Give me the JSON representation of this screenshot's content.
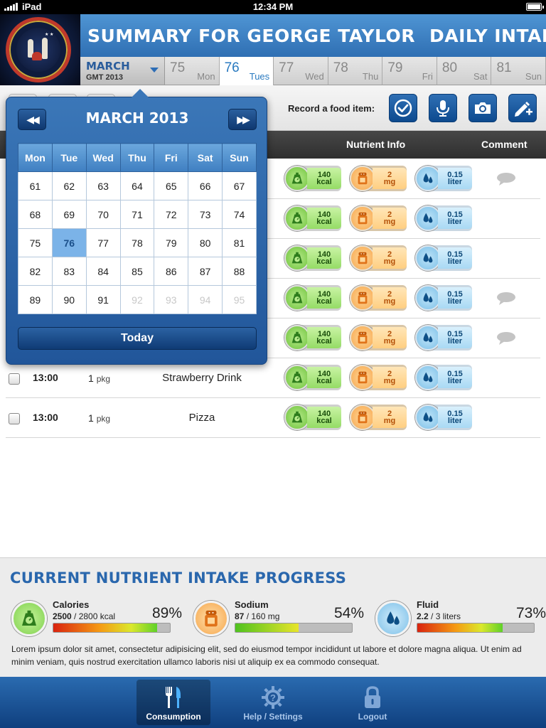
{
  "status_bar": {
    "carrier": "iPad",
    "time": "12:34 PM"
  },
  "header": {
    "title_left": "SUMMARY FOR GEORGE TAYLOR",
    "title_right": "DAILY INTAKE REPORT"
  },
  "date_selector": {
    "month": "MARCH",
    "timezone": "GMT 2013",
    "days": [
      {
        "num": "75",
        "weekday": "Mon"
      },
      {
        "num": "76",
        "weekday": "Tues"
      },
      {
        "num": "77",
        "weekday": "Wed"
      },
      {
        "num": "78",
        "weekday": "Thu"
      },
      {
        "num": "79",
        "weekday": "Fri"
      },
      {
        "num": "80",
        "weekday": "Sat"
      },
      {
        "num": "81",
        "weekday": "Sun"
      }
    ],
    "selected_day": "76"
  },
  "toolbar": {
    "record_label": "Record a food item:",
    "actions": [
      "checkmark-icon",
      "microphone-icon",
      "camera-icon",
      "edit-add-icon"
    ]
  },
  "table": {
    "headers": {
      "nutrient": "Nutrient Info",
      "comment": "Comment"
    },
    "rows": [
      {
        "time": "",
        "qty": "",
        "unit": "",
        "name": "",
        "kcal": "140",
        "kcal_unit": "kcal",
        "sodium": "2",
        "sodium_unit": "mg",
        "fluid": "0.15",
        "fluid_unit": "liter",
        "comment": true
      },
      {
        "time": "",
        "qty": "",
        "unit": "",
        "name": "",
        "kcal": "140",
        "kcal_unit": "kcal",
        "sodium": "2",
        "sodium_unit": "mg",
        "fluid": "0.15",
        "fluid_unit": "liter",
        "comment": false
      },
      {
        "time": "",
        "qty": "",
        "unit": "",
        "name": "",
        "kcal": "140",
        "kcal_unit": "kcal",
        "sodium": "2",
        "sodium_unit": "mg",
        "fluid": "0.15",
        "fluid_unit": "liter",
        "comment": false
      },
      {
        "time": "",
        "qty": "",
        "unit": "",
        "name": "",
        "kcal": "140",
        "kcal_unit": "kcal",
        "sodium": "2",
        "sodium_unit": "mg",
        "fluid": "0.15",
        "fluid_unit": "liter",
        "comment": true
      },
      {
        "time": "",
        "qty": "",
        "unit": "",
        "name": "",
        "kcal": "140",
        "kcal_unit": "kcal",
        "sodium": "2",
        "sodium_unit": "mg",
        "fluid": "0.15",
        "fluid_unit": "liter",
        "comment": true
      },
      {
        "time": "13:00",
        "qty": "1",
        "unit": "pkg",
        "name": "Strawberry Drink",
        "kcal": "140",
        "kcal_unit": "kcal",
        "sodium": "2",
        "sodium_unit": "mg",
        "fluid": "0.15",
        "fluid_unit": "liter",
        "comment": false
      },
      {
        "time": "13:00",
        "qty": "1",
        "unit": "pkg",
        "name": "Pizza",
        "kcal": "140",
        "kcal_unit": "kcal",
        "sodium": "2",
        "sodium_unit": "mg",
        "fluid": "0.15",
        "fluid_unit": "liter",
        "comment": false
      }
    ]
  },
  "calendar": {
    "title": "MARCH 2013",
    "weekdays": [
      "Mon",
      "Tue",
      "Wed",
      "Thu",
      "Fri",
      "Sat",
      "Sun"
    ],
    "weeks": [
      [
        "61",
        "62",
        "63",
        "64",
        "65",
        "66",
        "67"
      ],
      [
        "68",
        "69",
        "70",
        "71",
        "72",
        "73",
        "74"
      ],
      [
        "75",
        "76",
        "77",
        "78",
        "79",
        "80",
        "81"
      ],
      [
        "82",
        "83",
        "84",
        "85",
        "86",
        "87",
        "88"
      ],
      [
        "89",
        "90",
        "91",
        "92",
        "93",
        "94",
        "95"
      ]
    ],
    "dimmed_days": [
      "92",
      "93",
      "94",
      "95"
    ],
    "selected": "76",
    "today_label": "Today"
  },
  "progress": {
    "title": "CURRENT NUTRIENT INTAKE PROGRESS",
    "items": [
      {
        "name": "Calories",
        "current": "2500",
        "target": " / 2800 kcal",
        "percent_label": "89%",
        "fill_fraction": 0.89,
        "icon": "scale-icon"
      },
      {
        "name": "Sodium",
        "current": "87",
        "target": " / 160 mg",
        "percent_label": "54%",
        "fill_fraction": 0.54,
        "icon": "salt-shaker-icon"
      },
      {
        "name": "Fluid",
        "current": "2.2",
        "target": " / 3 liters",
        "percent_label": "73%",
        "fill_fraction": 0.73,
        "icon": "water-drop-icon"
      }
    ],
    "description": "Lorem ipsum dolor sit amet, consectetur adipisicing elit, sed do eiusmod tempor incididunt ut labore et dolore magna aliqua. Ut enim ad minim veniam, quis nostrud exercitation ullamco laboris nisi ut aliquip ex ea commodo consequat."
  },
  "tabbar": {
    "tabs": [
      {
        "label": "Consumption",
        "icon": "fork-knife-icon",
        "active": true
      },
      {
        "label": "Help / Settings",
        "icon": "gear-help-icon",
        "active": false
      },
      {
        "label": "Logout",
        "icon": "lock-icon",
        "active": false
      }
    ]
  },
  "colors": {
    "accent_blue": "#2f6fb3",
    "calories_green": "#7fd24c",
    "sodium_orange": "#f6a64b",
    "fluid_blue": "#7cc0e8"
  }
}
